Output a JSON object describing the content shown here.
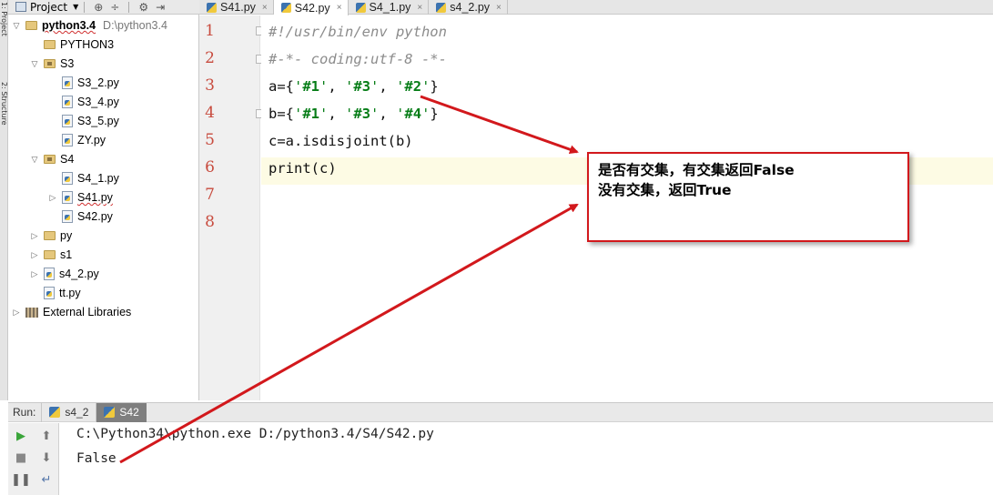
{
  "left_strip": {
    "tab1": "1: Project",
    "tab2": "2: Structure"
  },
  "project_panel": {
    "title": "Project",
    "tree": [
      {
        "label": "python3.4",
        "path": "D:\\python3.4",
        "type": "folder",
        "depth": 0,
        "expanded": true,
        "bold": true,
        "squiggle": true
      },
      {
        "label": "PYTHON3",
        "type": "folder",
        "depth": 1,
        "expanded": false,
        "has_arrow": false
      },
      {
        "label": "S3",
        "type": "folder",
        "depth": 1,
        "expanded": true,
        "package": true
      },
      {
        "label": "S3_2.py",
        "type": "py",
        "depth": 2
      },
      {
        "label": "S3_4.py",
        "type": "py",
        "depth": 2
      },
      {
        "label": "S3_5.py",
        "type": "py",
        "depth": 2
      },
      {
        "label": "ZY.py",
        "type": "py",
        "depth": 2
      },
      {
        "label": "S4",
        "type": "folder",
        "depth": 1,
        "expanded": true,
        "package": true
      },
      {
        "label": "S4_1.py",
        "type": "py",
        "depth": 2
      },
      {
        "label": "S41.py",
        "type": "py",
        "depth": 2,
        "has_arrow": true,
        "squiggle": true
      },
      {
        "label": "S42.py",
        "type": "py",
        "depth": 2
      },
      {
        "label": "py",
        "type": "folder",
        "depth": 1,
        "has_arrow": true
      },
      {
        "label": "s1",
        "type": "folder",
        "depth": 1,
        "has_arrow": true
      },
      {
        "label": "s4_2.py",
        "type": "py",
        "depth": 1,
        "has_arrow": true
      },
      {
        "label": "tt.py",
        "type": "py",
        "depth": 1
      },
      {
        "label": "External Libraries",
        "type": "libs",
        "depth": 0,
        "has_arrow": true
      }
    ]
  },
  "editor_tabs": [
    {
      "label": "S41.py",
      "active": false
    },
    {
      "label": "S42.py",
      "active": true
    },
    {
      "label": "S4_1.py",
      "active": false
    },
    {
      "label": "s4_2.py",
      "active": false
    }
  ],
  "editor": {
    "line_numbers": [
      "1",
      "2",
      "3",
      "4",
      "5",
      "6",
      "7",
      "8"
    ],
    "lines": [
      "#!/usr/bin/env python",
      "#-*- coding:utf-8 -*-",
      "a={'#1', '#3', '#2'}",
      "b={'#1', '#3', '#4'}",
      "c=a.isdisjoint(b)",
      "print(c)",
      "",
      ""
    ]
  },
  "annotation": {
    "line1": "是否有交集，有交集返回False",
    "line2": "没有交集，返回True",
    "color": "#d2181c"
  },
  "run_panel": {
    "label": "Run:",
    "tabs": [
      {
        "label": "s4_2",
        "active": false
      },
      {
        "label": "S42",
        "active": true
      }
    ],
    "console": [
      "C:\\Python34\\python.exe D:/python3.4/S4/S42.py",
      "False"
    ]
  }
}
